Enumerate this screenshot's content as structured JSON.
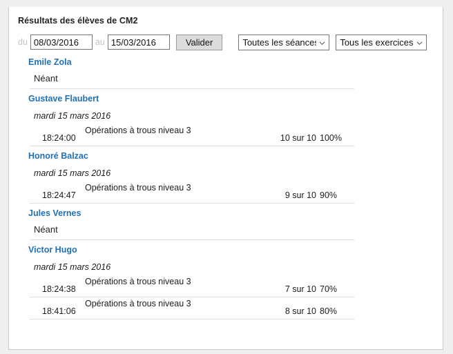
{
  "page": {
    "title": "Résultats des élèves de CM2"
  },
  "filters": {
    "from_label": "du",
    "from_value": "08/03/2016",
    "to_label": "au",
    "to_value": "15/03/2016",
    "validate_label": "Valider",
    "sessions_select": {
      "selected": "Toutes les séances",
      "icon": "chevron-down-icon"
    },
    "exercises_select": {
      "selected": "Tous les exercices",
      "icon": "chevron-down-icon"
    }
  },
  "labels": {
    "empty": "Néant"
  },
  "colors": {
    "student_name": "#1f70b5",
    "page_background": "#efefef",
    "panel_background": "#ffffff",
    "divider": "#dddddd",
    "button_face": "#dcdcdc"
  },
  "students": [
    {
      "name": "Emile Zola",
      "empty": "Néant",
      "sessions": []
    },
    {
      "name": "Gustave Flaubert",
      "empty": null,
      "sessions": [
        {
          "date": "mardi 15 mars 2016",
          "attempts": [
            {
              "time": "18:24:00",
              "exercise": "Opérations à trous niveau 3",
              "score": "10 sur 10",
              "percent": "100%"
            }
          ]
        }
      ]
    },
    {
      "name": "Honoré Balzac",
      "empty": null,
      "sessions": [
        {
          "date": "mardi 15 mars 2016",
          "attempts": [
            {
              "time": "18:24:47",
              "exercise": "Opérations à trous niveau 3",
              "score": "9 sur 10",
              "percent": "90%"
            }
          ]
        }
      ]
    },
    {
      "name": "Jules Vernes",
      "empty": "Néant",
      "sessions": []
    },
    {
      "name": "Victor Hugo",
      "empty": null,
      "sessions": [
        {
          "date": "mardi 15 mars 2016",
          "attempts": [
            {
              "time": "18:24:38",
              "exercise": "Opérations à trous niveau 3",
              "score": "7 sur 10",
              "percent": "70%"
            },
            {
              "time": "18:41:06",
              "exercise": "Opérations à trous niveau 3",
              "score": "8 sur 10",
              "percent": "80%"
            }
          ]
        }
      ]
    }
  ]
}
